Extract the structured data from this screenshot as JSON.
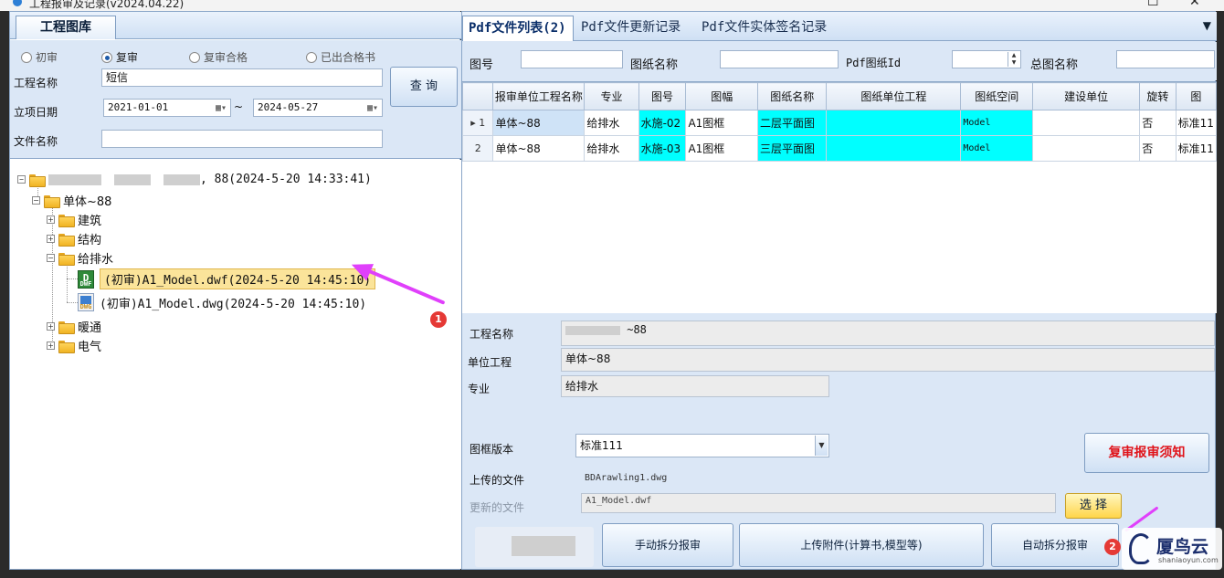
{
  "window": {
    "title": "工程报审及记录(v2024.04.22)"
  },
  "left": {
    "tab_label": "工程图库",
    "radios": [
      {
        "label": "初审",
        "checked": false
      },
      {
        "label": "复审",
        "checked": true
      },
      {
        "label": "复审合格",
        "checked": false
      },
      {
        "label": "已出合格书",
        "checked": false
      }
    ],
    "project_name_label": "工程名称",
    "project_name_value": "短信",
    "date_label": "立项日期",
    "date_from": "2021-01-01",
    "date_sep": "~",
    "date_to": "2024-05-27",
    "file_name_label": "文件名称",
    "file_name_value": "",
    "query_button": "查 询",
    "tree": {
      "root": ", 88(2024-5-20 14:33:41)",
      "unit": "单体~88",
      "majors": [
        "建筑",
        "结构",
        "给排水",
        "暖通",
        "电气"
      ],
      "file_dwf": "(初审)A1_Model.dwf(2024-5-20 14:45:10)",
      "file_dwg": "(初审)A1_Model.dwg(2024-5-20 14:45:10)",
      "dwf_tag": "DWF",
      "dwg_tag": "DWG"
    }
  },
  "right": {
    "tabs": [
      "Pdf文件列表(2)",
      "Pdf文件更新记录",
      "Pdf文件实体签名记录"
    ],
    "search": {
      "drawing_no_label": "图号",
      "drawing_name_label": "图纸名称",
      "pdf_id_label": "Pdf图纸Id",
      "master_name_label": "总图名称"
    },
    "grid": {
      "columns": [
        "报审单位工程名称",
        "专业",
        "图号",
        "图幅",
        "图纸名称",
        "图纸单位工程",
        "图纸空间",
        "建设单位",
        "旋转",
        "图"
      ],
      "rows": [
        {
          "num": "1",
          "cells": [
            "单体~88",
            "给排水",
            "水施-02",
            "A1图框",
            "二层平面图",
            "",
            "Model",
            "",
            "否",
            "标准11"
          ]
        },
        {
          "num": "2",
          "cells": [
            "单体~88",
            "给排水",
            "水施-03",
            "A1图框",
            "三层平面图",
            "",
            "Model",
            "",
            "否",
            "标准11"
          ]
        }
      ]
    },
    "details": {
      "project_label": "工程名称",
      "project_value": "~88",
      "unit_label": "单位工程",
      "unit_value": "单体~88",
      "major_label": "专业",
      "major_value": "给排水",
      "frame_version_label": "图框版本",
      "frame_version_value": "标准111",
      "uploaded_label": "上传的文件",
      "uploaded_value": "BDArawling1.dwg",
      "updated_label": "更新的文件",
      "updated_value": "A1_Model.dwf"
    },
    "buttons": {
      "notice": "复审报审须知",
      "choose": "选 择",
      "manual_split": "手动拆分报审",
      "upload_attach": "上传附件(计算书,模型等)",
      "auto_split": "自动拆分报审"
    }
  },
  "annotations": {
    "badge1": "1",
    "badge2": "2"
  },
  "watermark": {
    "name": "厦鸟云",
    "url": "shaniaoyun.com"
  },
  "colors": {
    "highlight_cyan": "#00ffff",
    "annotation_magenta": "#e040fb",
    "badge_red": "#e53935"
  }
}
